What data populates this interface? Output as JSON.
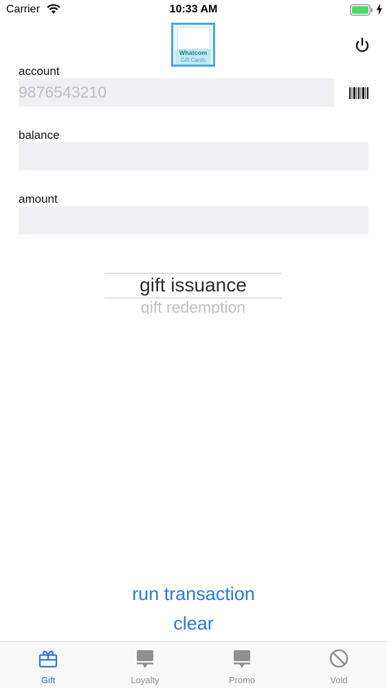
{
  "status_bar": {
    "carrier": "Carrier",
    "time": "10:33 AM",
    "icons": [
      "wifi-icon",
      "battery-icon",
      "charging-bolt-icon"
    ]
  },
  "header": {
    "logo": {
      "title": "Whatcom",
      "subtitle": "Gift Cards"
    },
    "power_icon": "power-icon"
  },
  "form": {
    "account": {
      "label": "account",
      "value": "9876543210",
      "scan_icon": "barcode-icon"
    },
    "balance": {
      "label": "balance",
      "value": ""
    },
    "amount": {
      "label": "amount",
      "value": ""
    }
  },
  "picker": {
    "selected": "gift issuance",
    "next": "gift redemption"
  },
  "actions": {
    "run_label": "run transaction",
    "clear_label": "clear"
  },
  "tabs": [
    {
      "label": "Gift",
      "icon": "gift-icon",
      "active": true
    },
    {
      "label": "Loyalty",
      "icon": "loyalty-icon",
      "active": false
    },
    {
      "label": "Promo",
      "icon": "promo-icon",
      "active": false
    },
    {
      "label": "Void",
      "icon": "void-icon",
      "active": false
    }
  ],
  "colors": {
    "accent": "#2a7ad5",
    "field_bg": "#f0eff4",
    "inactive_tab": "#8e8e93"
  }
}
